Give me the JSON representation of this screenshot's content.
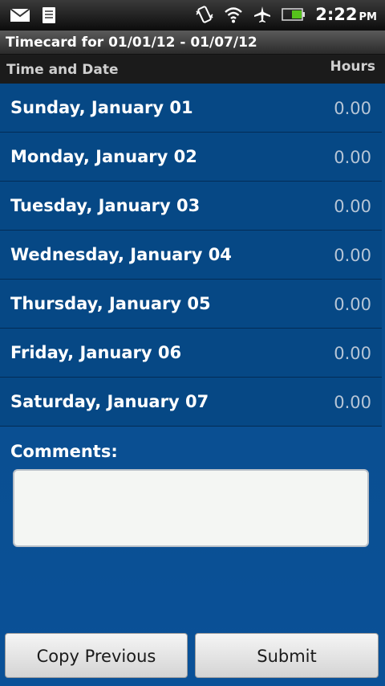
{
  "statusbar": {
    "time": "2:22",
    "ampm": "PM",
    "icons": [
      "mail-icon",
      "notes-icon",
      "vibrate-icon",
      "wifi-icon",
      "airplane-icon",
      "battery-icon"
    ]
  },
  "title": "Timecard for 01/01/12 - 01/07/12",
  "columns": {
    "left": "Time and Date",
    "right": "Hours"
  },
  "days": [
    {
      "label": "Sunday, January 01",
      "hours": "0.00"
    },
    {
      "label": "Monday, January 02",
      "hours": "0.00"
    },
    {
      "label": "Tuesday, January 03",
      "hours": "0.00"
    },
    {
      "label": "Wednesday, January 04",
      "hours": "0.00"
    },
    {
      "label": "Thursday, January 05",
      "hours": "0.00"
    },
    {
      "label": "Friday, January 06",
      "hours": "0.00"
    },
    {
      "label": "Saturday, January 07",
      "hours": "0.00"
    }
  ],
  "comments": {
    "label": "Comments:",
    "value": ""
  },
  "buttons": {
    "copy": "Copy Previous",
    "submit": "Submit"
  },
  "colors": {
    "background": "#0a4e8f",
    "row_border": "#032c55",
    "hours_text": "#b6c5d6"
  }
}
